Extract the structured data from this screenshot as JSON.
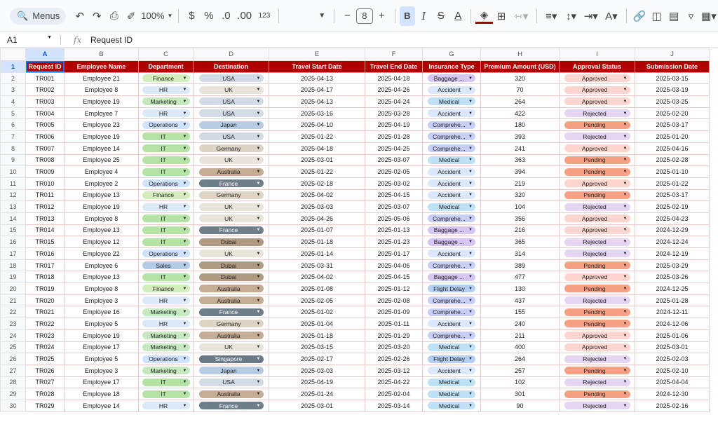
{
  "toolbar": {
    "menus_label": "Menus",
    "zoom": "100%",
    "currency": "$",
    "percent": "%",
    "dec_less": ".0",
    "dec_more": ".00",
    "num_format": "123",
    "font_size": "8"
  },
  "formula_bar": {
    "cell_ref": "A1",
    "value": "Request ID"
  },
  "columns": [
    "A",
    "B",
    "C",
    "D",
    "E",
    "F",
    "G",
    "H",
    "I",
    "J"
  ],
  "headers": [
    "Request ID",
    "Employee Name",
    "Department",
    "Destination",
    "Travel Start Date",
    "Travel End Date",
    "Insurance Type",
    "Premium Amount (USD)",
    "Approval Status",
    "Submission Date"
  ],
  "chip_colors": {
    "Finance": "#d4edbc",
    "HR": "#dbe9f8",
    "Marketing": "#c7e9c0",
    "Operations": "#cfe2ff",
    "IT": "#b5e3a5",
    "Sales": "#b3cde8",
    "USA": "#d2dbe6",
    "UK": "#e8e4da",
    "Japan": "#b8cde4",
    "Germany": "#ddd5c6",
    "Australia": "#c4ad94",
    "France": "#6f7f89",
    "Dubai": "#b09b82",
    "Singapore": "#6a7888",
    "Baggage ...": "#d7c6f4",
    "Accident": "#dbe8fb",
    "Medical": "#bfe1f6",
    "Comprehe...": "#c8cff7",
    "Flight Delay": "#b5cff3",
    "Approved": "#ffd6cf",
    "Rejected": "#e5d4f2",
    "Pending": "#f7a184"
  },
  "rows": [
    [
      "TR001",
      "Employee 21",
      "Finance",
      "USA",
      "2025-04-13",
      "2025-04-18",
      "Baggage ...",
      "320",
      "Approved",
      "2025-03-15"
    ],
    [
      "TR002",
      "Employee 8",
      "HR",
      "UK",
      "2025-04-17",
      "2025-04-26",
      "Accident",
      "70",
      "Approved",
      "2025-03-19"
    ],
    [
      "TR003",
      "Employee 19",
      "Marketing",
      "USA",
      "2025-04-13",
      "2025-04-24",
      "Medical",
      "264",
      "Approved",
      "2025-03-25"
    ],
    [
      "TR004",
      "Employee 7",
      "HR",
      "USA",
      "2025-03-16",
      "2025-03-28",
      "Accident",
      "422",
      "Rejected",
      "2025-02-20"
    ],
    [
      "TR005",
      "Employee 23",
      "Operations",
      "Japan",
      "2025-04-10",
      "2025-04-19",
      "Comprehe...",
      "180",
      "Pending",
      "2025-03-17"
    ],
    [
      "TR006",
      "Employee 19",
      "IT",
      "USA",
      "2025-01-22",
      "2025-01-28",
      "Comprehe...",
      "393",
      "Rejected",
      "2025-01-20"
    ],
    [
      "TR007",
      "Employee 14",
      "IT",
      "Germany",
      "2025-04-18",
      "2025-04-25",
      "Comprehe...",
      "241",
      "Approved",
      "2025-04-16"
    ],
    [
      "TR008",
      "Employee 25",
      "IT",
      "UK",
      "2025-03-01",
      "2025-03-07",
      "Medical",
      "363",
      "Pending",
      "2025-02-28"
    ],
    [
      "TR009",
      "Employee 4",
      "IT",
      "Australia",
      "2025-01-22",
      "2025-02-05",
      "Accident",
      "394",
      "Pending",
      "2025-01-10"
    ],
    [
      "TR010",
      "Employee 2",
      "Operations",
      "France",
      "2025-02-18",
      "2025-03-02",
      "Accident",
      "219",
      "Approved",
      "2025-01-22"
    ],
    [
      "TR011",
      "Employee 13",
      "Finance",
      "Germany",
      "2025-04-02",
      "2025-04-15",
      "Accident",
      "320",
      "Pending",
      "2025-03-17"
    ],
    [
      "TR012",
      "Employee 19",
      "HR",
      "UK",
      "2025-03-03",
      "2025-03-07",
      "Medical",
      "104",
      "Rejected",
      "2025-02-19"
    ],
    [
      "TR013",
      "Employee 8",
      "IT",
      "UK",
      "2025-04-26",
      "2025-05-06",
      "Comprehe...",
      "356",
      "Approved",
      "2025-04-23"
    ],
    [
      "TR014",
      "Employee 13",
      "IT",
      "France",
      "2025-01-07",
      "2025-01-13",
      "Baggage ...",
      "216",
      "Approved",
      "2024-12-29"
    ],
    [
      "TR015",
      "Employee 12",
      "IT",
      "Dubai",
      "2025-01-18",
      "2025-01-23",
      "Baggage ...",
      "365",
      "Rejected",
      "2024-12-24"
    ],
    [
      "TR016",
      "Employee 22",
      "Operations",
      "UK",
      "2025-01-14",
      "2025-01-17",
      "Accident",
      "314",
      "Rejected",
      "2024-12-19"
    ],
    [
      "TR017",
      "Employee 6",
      "Sales",
      "Dubai",
      "2025-03-31",
      "2025-04-06",
      "Comprehe...",
      "389",
      "Pending",
      "2025-03-29"
    ],
    [
      "TR018",
      "Employee 13",
      "IT",
      "Dubai",
      "2025-04-02",
      "2025-04-15",
      "Baggage ...",
      "477",
      "Approved",
      "2025-03-26"
    ],
    [
      "TR019",
      "Employee 8",
      "Finance",
      "Australia",
      "2025-01-08",
      "2025-01-12",
      "Flight Delay",
      "130",
      "Pending",
      "2024-12-25"
    ],
    [
      "TR020",
      "Employee 3",
      "HR",
      "Australia",
      "2025-02-05",
      "2025-02-08",
      "Comprehe...",
      "437",
      "Rejected",
      "2025-01-28"
    ],
    [
      "TR021",
      "Employee 16",
      "Marketing",
      "France",
      "2025-01-02",
      "2025-01-09",
      "Comprehe...",
      "155",
      "Pending",
      "2024-12-11"
    ],
    [
      "TR022",
      "Employee 5",
      "HR",
      "Germany",
      "2025-01-04",
      "2025-01-11",
      "Accident",
      "240",
      "Pending",
      "2024-12-06"
    ],
    [
      "TR023",
      "Employee 19",
      "Marketing",
      "Australia",
      "2025-01-18",
      "2025-01-29",
      "Comprehe...",
      "211",
      "Approved",
      "2025-01-06"
    ],
    [
      "TR024",
      "Employee 17",
      "Marketing",
      "UK",
      "2025-03-15",
      "2025-03-20",
      "Medical",
      "400",
      "Approved",
      "2025-03-01"
    ],
    [
      "TR025",
      "Employee 5",
      "Operations",
      "Singapore",
      "2025-02-17",
      "2025-02-26",
      "Flight Delay",
      "264",
      "Rejected",
      "2025-02-03"
    ],
    [
      "TR026",
      "Employee 3",
      "Marketing",
      "Japan",
      "2025-03-03",
      "2025-03-12",
      "Accident",
      "257",
      "Pending",
      "2025-02-10"
    ],
    [
      "TR027",
      "Employee 17",
      "IT",
      "USA",
      "2025-04-19",
      "2025-04-22",
      "Medical",
      "102",
      "Rejected",
      "2025-04-04"
    ],
    [
      "TR028",
      "Employee 18",
      "IT",
      "Australia",
      "2025-01-24",
      "2025-02-04",
      "Medical",
      "301",
      "Pending",
      "2024-12-30"
    ],
    [
      "TR029",
      "Employee 14",
      "HR",
      "France",
      "2025-03-01",
      "2025-03-14",
      "Medical",
      "90",
      "Rejected",
      "2025-02-16"
    ]
  ]
}
